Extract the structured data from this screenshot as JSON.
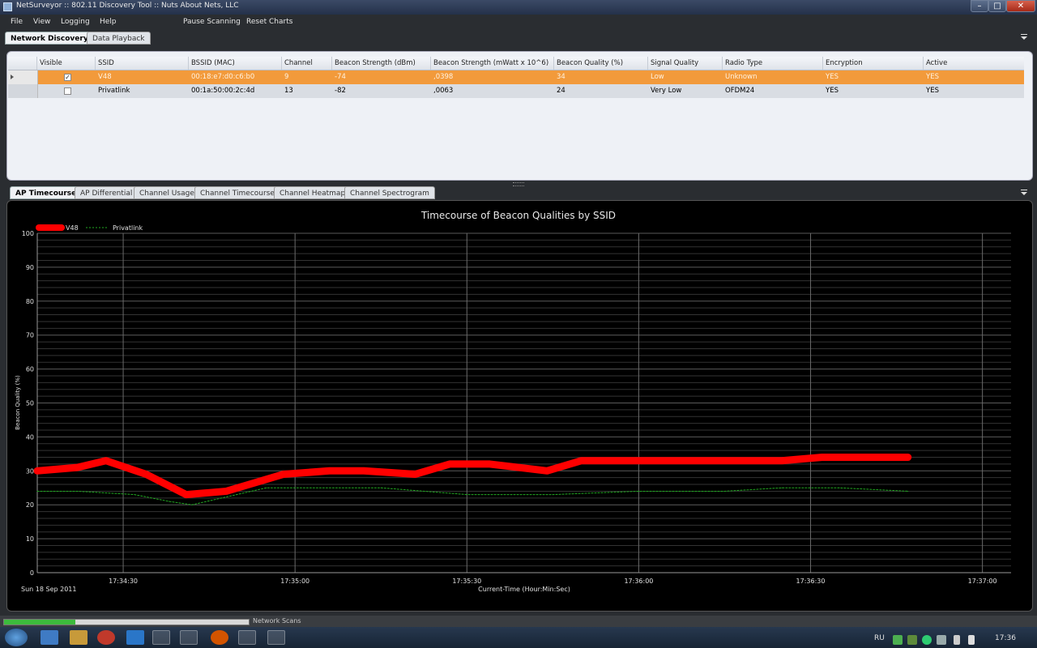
{
  "window": {
    "title": "NetSurveyor :: 802.11 Discovery Tool :: Nuts About Nets, LLC"
  },
  "menu": {
    "file": "File",
    "view": "View",
    "logging": "Logging",
    "help": "Help",
    "pause": "Pause Scanning",
    "reset": "Reset Charts"
  },
  "top_tabs": [
    "Network Discovery",
    "Data Playback"
  ],
  "table": {
    "headers": [
      "Visible",
      "SSID",
      "BSSID (MAC)",
      "Channel",
      "Beacon Strength (dBm)",
      "Beacon Strength (mWatt x 10^6)",
      "Beacon Quality (%)",
      "Signal Quality",
      "Radio Type",
      "Encryption",
      "Active"
    ],
    "rows": [
      {
        "visible": true,
        "ssid": "V48",
        "bssid": "00:18:e7:d0:c6:b0",
        "channel": "9",
        "dbm": "-74",
        "mwatt": ",0398",
        "quality": "34",
        "signal": "Low",
        "radio": "Unknown",
        "encryption": "YES",
        "active": "YES"
      },
      {
        "visible": false,
        "ssid": "Privatlink",
        "bssid": "00:1a:50:00:2c:4d",
        "channel": "13",
        "dbm": "-82",
        "mwatt": ",0063",
        "quality": "24",
        "signal": "Very Low",
        "radio": "OFDM24",
        "encryption": "YES",
        "active": "YES"
      }
    ]
  },
  "bottom_tabs": [
    "AP Timecourse",
    "AP Differential",
    "Channel Usage",
    "Channel Timecourse",
    "Channel Heatmap",
    "Channel Spectrogram"
  ],
  "chart_data": {
    "type": "line",
    "title": "Timecourse of Beacon Qualities by SSID",
    "xlabel": "Current-Time (Hour:Min:Sec)",
    "ylabel": "Beacon Quality (%)",
    "date_label": "Sun 18 Sep 2011",
    "ylim": [
      0,
      100
    ],
    "yticks": [
      0,
      10,
      20,
      30,
      40,
      50,
      60,
      70,
      80,
      90,
      100
    ],
    "xlim": [
      "17:34:15",
      "17:37:05"
    ],
    "xticks": [
      "17:34:30",
      "17:35:00",
      "17:35:30",
      "17:36:00",
      "17:36:30",
      "17:37:00"
    ],
    "grid": true,
    "legend": "top-left",
    "series": [
      {
        "name": "V48",
        "color": "#ff0000",
        "style": "thick",
        "x": [
          "17:34:15",
          "17:34:22",
          "17:34:27",
          "17:34:34",
          "17:34:41",
          "17:34:48",
          "17:34:58",
          "17:35:06",
          "17:35:12",
          "17:35:21",
          "17:35:27",
          "17:35:34",
          "17:35:44",
          "17:35:50",
          "17:35:57",
          "17:36:04",
          "17:36:15",
          "17:36:25",
          "17:36:32",
          "17:36:40",
          "17:36:47"
        ],
        "y": [
          30,
          31,
          33,
          29,
          23,
          24,
          29,
          30,
          30,
          29,
          32,
          32,
          30,
          33,
          33,
          33,
          33,
          33,
          34,
          34,
          34
        ]
      },
      {
        "name": "Privatlink",
        "color": "#22aa22",
        "style": "dashed",
        "x": [
          "17:34:15",
          "17:34:22",
          "17:34:32",
          "17:34:38",
          "17:34:42",
          "17:34:55",
          "17:35:15",
          "17:35:30",
          "17:35:45",
          "17:36:00",
          "17:36:15",
          "17:36:25",
          "17:36:35",
          "17:36:47"
        ],
        "y": [
          24,
          24,
          23,
          21,
          20,
          25,
          25,
          23,
          23,
          24,
          24,
          25,
          25,
          24
        ]
      }
    ]
  },
  "status": {
    "label": "Network Scans",
    "progress": 0.29
  },
  "tray": {
    "lang": "RU",
    "time": "17:36"
  }
}
